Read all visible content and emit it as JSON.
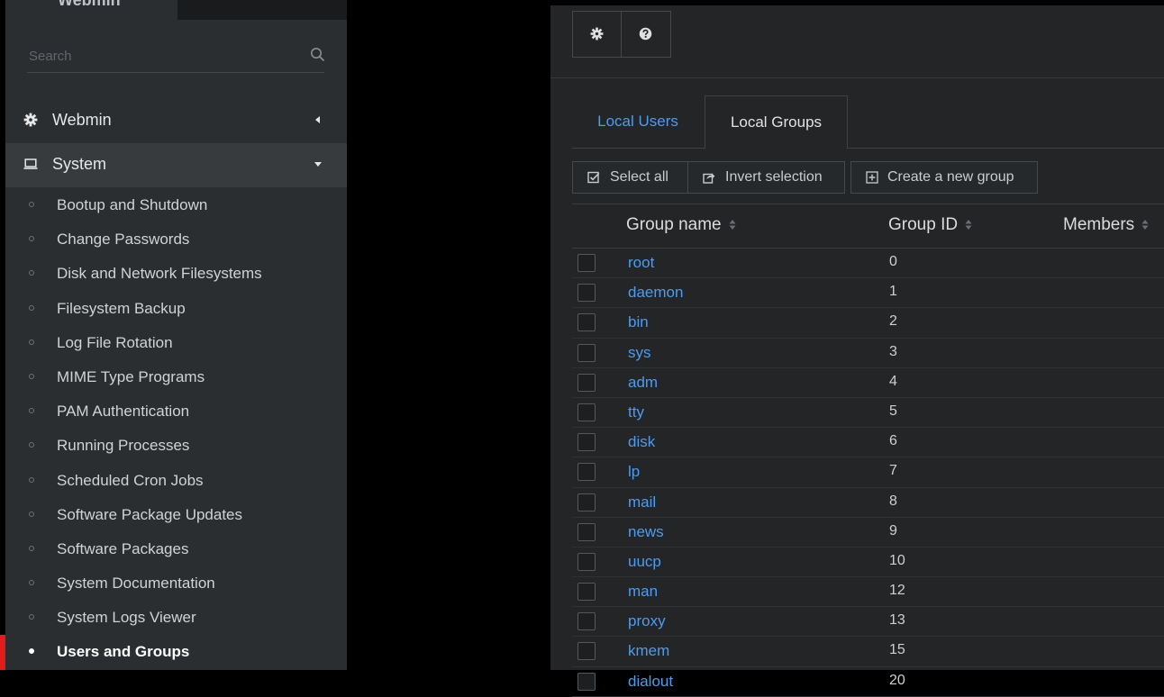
{
  "sidebar": {
    "brand": "Webmin",
    "search_placeholder": "Search",
    "categories": [
      {
        "label": "Webmin",
        "icon": "gear-icon",
        "expanded": false
      },
      {
        "label": "System",
        "icon": "laptop-icon",
        "expanded": true
      }
    ],
    "items": [
      {
        "label": "Bootup and Shutdown"
      },
      {
        "label": "Change Passwords"
      },
      {
        "label": "Disk and Network Filesystems"
      },
      {
        "label": "Filesystem Backup"
      },
      {
        "label": "Log File Rotation"
      },
      {
        "label": "MIME Type Programs"
      },
      {
        "label": "PAM Authentication"
      },
      {
        "label": "Running Processes"
      },
      {
        "label": "Scheduled Cron Jobs"
      },
      {
        "label": "Software Package Updates"
      },
      {
        "label": "Software Packages"
      },
      {
        "label": "System Documentation"
      },
      {
        "label": "System Logs Viewer"
      },
      {
        "label": "Users and Groups",
        "active": true
      }
    ],
    "accent_color": "#e21b1b"
  },
  "main": {
    "toolbar": {
      "buttons": [
        "gear-icon",
        "question-circle-icon"
      ]
    },
    "tabs": [
      {
        "label": "Local Users",
        "active": false
      },
      {
        "label": "Local Groups",
        "active": true
      }
    ],
    "actions": {
      "select_all": "Select all",
      "invert_selection": "Invert selection",
      "create_group": "Create a new group"
    },
    "table": {
      "columns": [
        "Group name",
        "Group ID",
        "Members"
      ],
      "rows": [
        {
          "name": "root",
          "id": "0"
        },
        {
          "name": "daemon",
          "id": "1"
        },
        {
          "name": "bin",
          "id": "2"
        },
        {
          "name": "sys",
          "id": "3"
        },
        {
          "name": "adm",
          "id": "4"
        },
        {
          "name": "tty",
          "id": "5"
        },
        {
          "name": "disk",
          "id": "6"
        },
        {
          "name": "lp",
          "id": "7"
        },
        {
          "name": "mail",
          "id": "8"
        },
        {
          "name": "news",
          "id": "9"
        },
        {
          "name": "uucp",
          "id": "10"
        },
        {
          "name": "man",
          "id": "12"
        },
        {
          "name": "proxy",
          "id": "13"
        },
        {
          "name": "kmem",
          "id": "15"
        },
        {
          "name": "dialout",
          "id": "20"
        }
      ]
    },
    "link_color": "#4d9cf0"
  }
}
